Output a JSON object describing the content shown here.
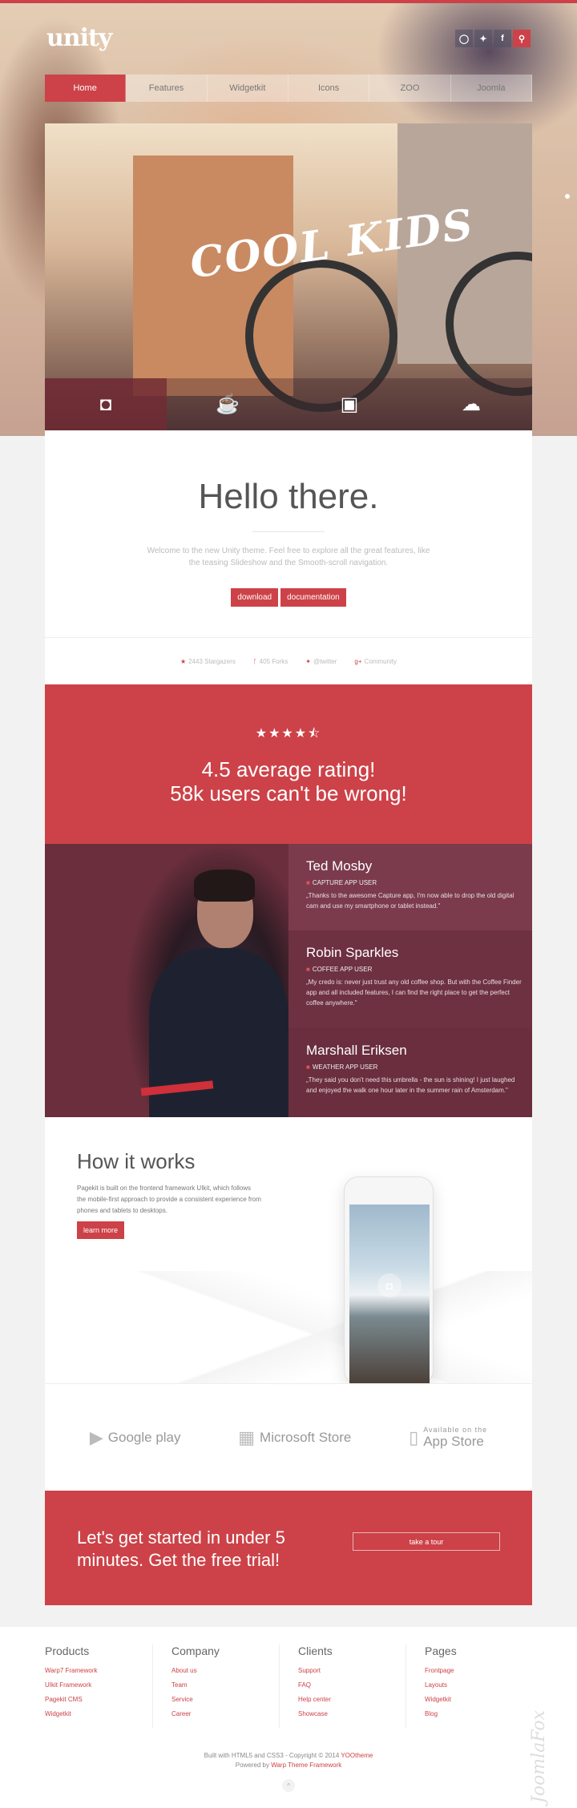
{
  "brand": {
    "logo": "unity",
    "accent": "#cc4248"
  },
  "social": [
    {
      "icon": "github-icon",
      "glyph": "◯"
    },
    {
      "icon": "twitter-icon",
      "glyph": "✦"
    },
    {
      "icon": "facebook-icon",
      "glyph": "f"
    },
    {
      "icon": "search-icon",
      "glyph": "⚲"
    }
  ],
  "nav": [
    "Home",
    "Features",
    "Widgetkit",
    "Icons",
    "ZOO",
    "Joomla"
  ],
  "slideshow": {
    "overlay_text": "COOL KIDS",
    "icons": [
      "camera-icon",
      "coffee-icon",
      "tv-icon",
      "weather-icon"
    ],
    "glyphs": [
      "◘",
      "☕",
      "▣",
      "☁"
    ]
  },
  "hello": {
    "title": "Hello there.",
    "text": "Welcome to the new Unity theme. Feel free to explore all the great features, like the teasing Slideshow and the Smooth-scroll navigation.",
    "download": "download",
    "documentation": "documentation"
  },
  "stats": [
    {
      "icon": "★",
      "label": "2443 Stargazers"
    },
    {
      "icon": "ᚴ",
      "label": "405 Forks"
    },
    {
      "icon": "✦",
      "label": "@twitter"
    },
    {
      "icon": "g+",
      "label": "Community"
    }
  ],
  "rating": {
    "stars": "★★★★⯪",
    "value": 4.5,
    "line1": "4.5 average rating!",
    "line2": "58k users can't be wrong!"
  },
  "testimonials": [
    {
      "name": "Ted Mosby",
      "role": "CAPTURE APP USER",
      "quote": "„Thanks to the awesome Capture app, I'm now able to drop the old digital cam and use my smartphone or tablet instead.\""
    },
    {
      "name": "Robin Sparkles",
      "role": "COFFEE APP USER",
      "quote": "„My credo is: never just trust any old coffee shop. But with the Coffee Finder app and all included features, I can find the right place to get the perfect coffee anywhere.\""
    },
    {
      "name": "Marshall Eriksen",
      "role": "WEATHER APP USER",
      "quote": "„They said you don't need this umbrella - the sun is shining! I just laughed and enjoyed the walk one hour later in the summer rain of Amsterdam.\""
    }
  ],
  "how": {
    "title": "How it works",
    "text": "Pagekit is built on the frontend framework UIkit, which follows the mobile-first approach to provide a consistent experience from phones and tablets to desktops.",
    "button": "learn more"
  },
  "stores": [
    {
      "label": "Google play",
      "small": ""
    },
    {
      "label": "Microsoft Store",
      "small": ""
    },
    {
      "label": "App Store",
      "small": "Available on the"
    }
  ],
  "cta": {
    "text": "Let's get started in under 5 minutes. Get the free trial!",
    "button": "take a tour"
  },
  "footer": {
    "columns": [
      {
        "title": "Products",
        "links": [
          "Warp7 Framework",
          "UIkit Framework",
          "Pagekit CMS",
          "Widgetkit"
        ]
      },
      {
        "title": "Company",
        "links": [
          "About us",
          "Team",
          "Service",
          "Career"
        ]
      },
      {
        "title": "Clients",
        "links": [
          "Support",
          "FAQ",
          "Help center",
          "Showcase"
        ]
      },
      {
        "title": "Pages",
        "links": [
          "Frontpage",
          "Layouts",
          "Widgetkit",
          "Blog"
        ]
      }
    ],
    "copy1": "Built with HTML5 and CSS3 - Copyright © 2014 ",
    "copy1_link": "YOOtheme",
    "copy2": "Powered by ",
    "copy2_link": "Warp Theme Framework",
    "totop": "^",
    "watermark": "JoomlaFox"
  }
}
